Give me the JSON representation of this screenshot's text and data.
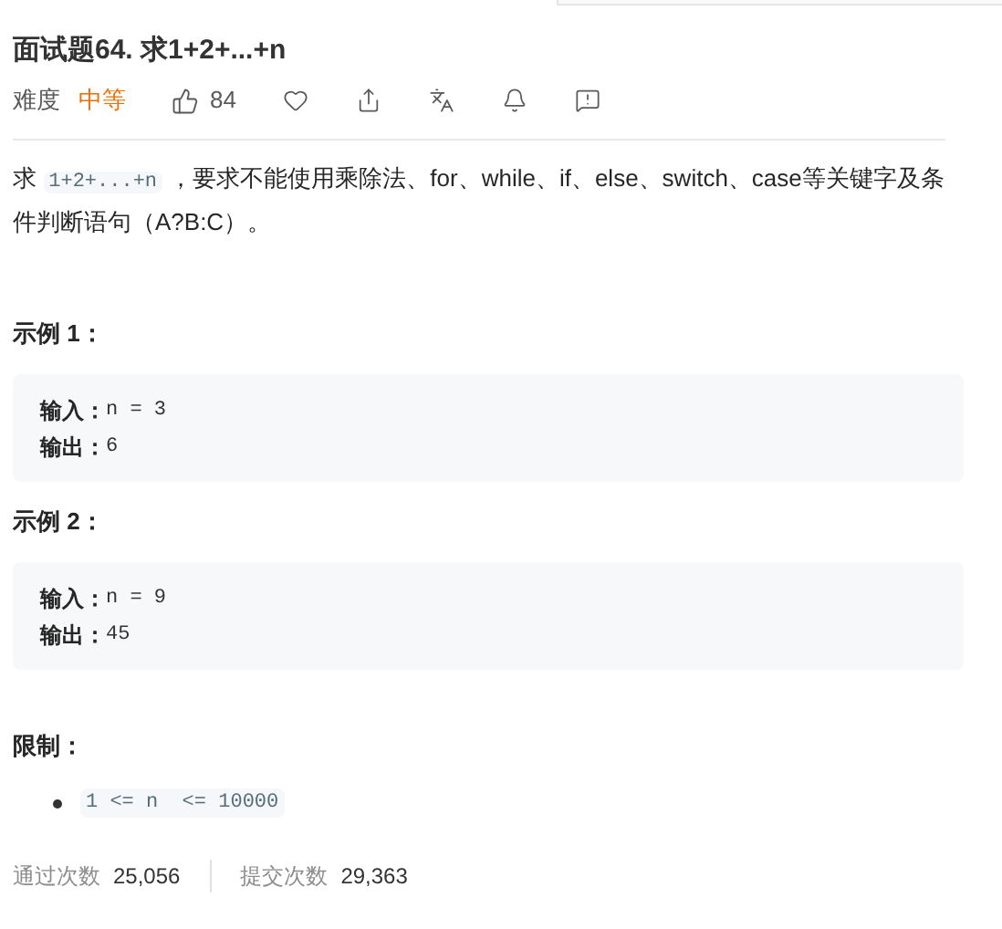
{
  "title": "面试题64. 求1+2+...+n",
  "meta": {
    "difficulty_label": "难度",
    "difficulty": "中等",
    "likes": "84"
  },
  "description": {
    "before": "求 ",
    "code": "1+2+...+n",
    "after": " ，要求不能使用乘除法、for、while、if、else、switch、case等关键字及条件判断语句（A?B:C）。"
  },
  "examples": [
    {
      "heading": "示例 1：",
      "lines": [
        {
          "label": "输入：",
          "value": "n = 3"
        },
        {
          "label": "输出：",
          "value": "6"
        }
      ]
    },
    {
      "heading": "示例 2：",
      "lines": [
        {
          "label": "输入：",
          "value": "n = 9"
        },
        {
          "label": "输出：",
          "value": "45"
        }
      ]
    }
  ],
  "constraints": {
    "heading": "限制：",
    "items": [
      "1 <= n  <= 10000"
    ]
  },
  "stats": [
    {
      "label": "通过次数",
      "value": "25,056"
    },
    {
      "label": "提交次数",
      "value": "29,363"
    }
  ]
}
